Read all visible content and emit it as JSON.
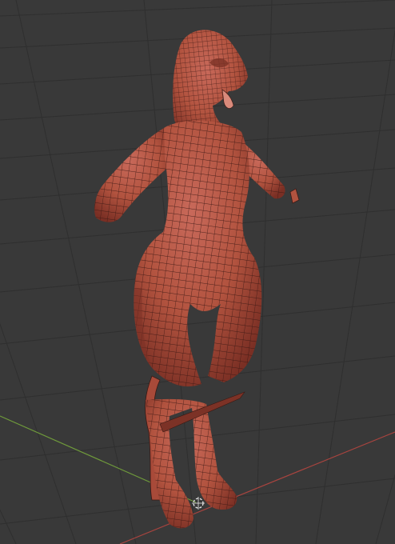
{
  "viewport": {
    "background": "#393939",
    "grid_color": "#2f2f2f",
    "x_axis_color": "#a8443f",
    "y_axis_color": "#6f9a3b",
    "mesh_color": "#b85a49",
    "mesh_shadow": "#7c3226",
    "wire_color": "#3a1813"
  },
  "scene": {
    "object_icon": "origin-cursor-icon",
    "model_icon": "character-mesh-icon"
  }
}
